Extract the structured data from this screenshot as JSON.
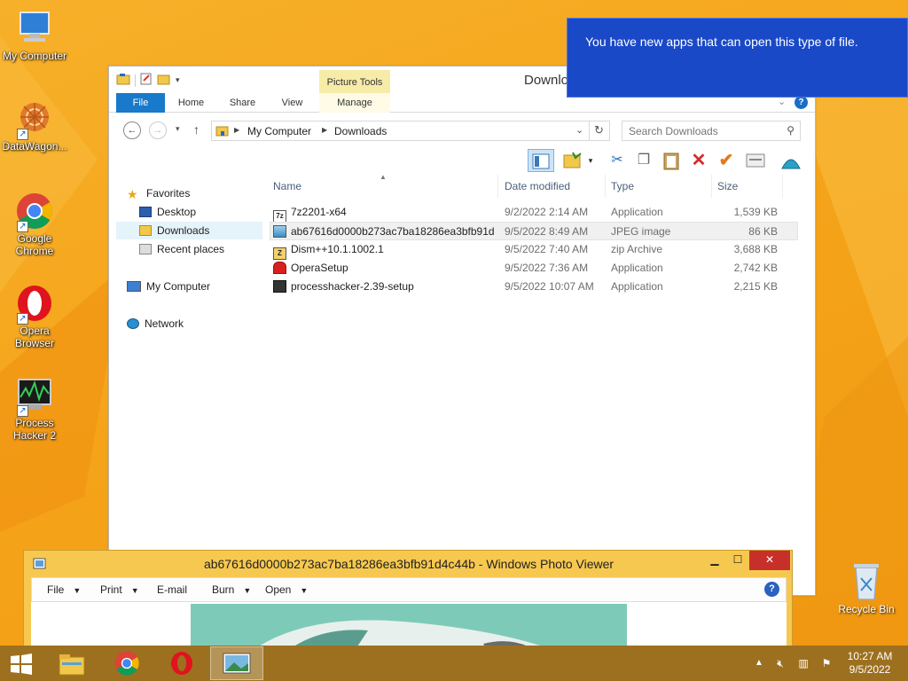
{
  "desktop": {
    "icons": [
      {
        "label": "My Computer",
        "icon": "computer-icon"
      },
      {
        "label": "DataWagon...",
        "icon": "datawagon-icon"
      },
      {
        "label": "Google Chrome",
        "line1": "Google",
        "line2": "Chrome",
        "icon": "chrome-icon"
      },
      {
        "label": "Opera Browser",
        "line1": "Opera",
        "line2": "Browser",
        "icon": "opera-icon"
      },
      {
        "label": "Process Hacker 2",
        "line1": "Process",
        "line2": "Hacker 2",
        "icon": "process-hacker-icon"
      }
    ],
    "recycle_bin": "Recycle Bin"
  },
  "toast": {
    "message": "You have new apps that can open this type of file."
  },
  "explorer": {
    "title": "Downlo",
    "context_tab": "Picture Tools",
    "tabs": [
      "File",
      "Home",
      "Share",
      "View",
      "Manage"
    ],
    "breadcrumb": [
      "My Computer",
      "Downloads"
    ],
    "search_placeholder": "Search Downloads",
    "nav": {
      "favorites": "Favorites",
      "desktop": "Desktop",
      "downloads": "Downloads",
      "recent": "Recent places",
      "computer": "My Computer",
      "network": "Network"
    },
    "columns": [
      "Name",
      "Date modified",
      "Type",
      "Size"
    ],
    "files": [
      {
        "name": "7z2201-x64",
        "date": "9/2/2022 2:14 AM",
        "type": "Application",
        "size": "1,539 KB"
      },
      {
        "name": "ab67616d0000b273ac7ba18286ea3bfb91d...",
        "date": "9/5/2022 8:49 AM",
        "type": "JPEG image",
        "size": "86 KB"
      },
      {
        "name": "Dism++10.1.1002.1",
        "date": "9/5/2022 7:40 AM",
        "type": "zip Archive",
        "size": "3,688 KB"
      },
      {
        "name": "OperaSetup",
        "date": "9/5/2022 7:36 AM",
        "type": "Application",
        "size": "2,742 KB"
      },
      {
        "name": "processhacker-2.39-setup",
        "date": "9/5/2022 10:07 AM",
        "type": "Application",
        "size": "2,215 KB"
      }
    ]
  },
  "viewer": {
    "title": "ab67616d0000b273ac7ba18286ea3bfb91d4c44b - Windows Photo Viewer",
    "menu": [
      "File",
      "Print",
      "E-mail",
      "Burn",
      "Open"
    ]
  },
  "taskbar": {
    "time": "10:27 AM",
    "date": "9/5/2022"
  },
  "colors": {
    "desktop": "#f5a51a",
    "toast": "#1a49c8",
    "file_tab": "#1979ca",
    "viewer_frame": "#f6c84f"
  }
}
